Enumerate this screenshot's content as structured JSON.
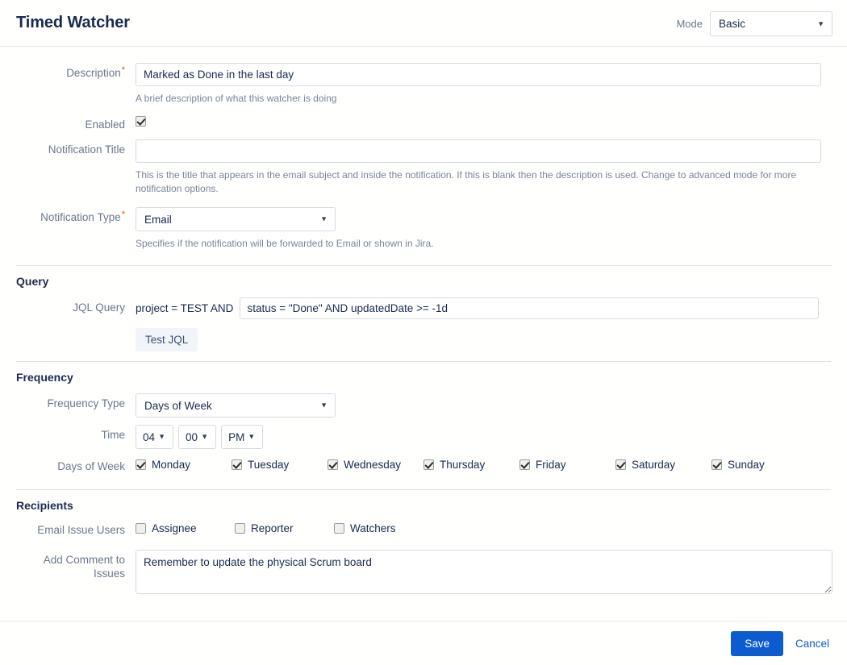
{
  "header": {
    "title": "Timed Watcher",
    "mode_label": "Mode",
    "mode_value": "Basic"
  },
  "general": {
    "description_label": "Description",
    "description_value": "Marked as Done in the last day",
    "description_placeholder": "",
    "description_help": "A brief description of what this watcher is doing",
    "enabled_label": "Enabled",
    "notification_title_label": "Notification Title",
    "notification_title_value": "",
    "notification_title_placeholder": "",
    "notification_title_help": "This is the title that appears in the email subject and inside the notification. If this is blank then the description is used. Change to advanced mode for more notification options.",
    "notification_type_label": "Notification Type",
    "notification_type_value": "Email",
    "notification_type_help": "Specifies if the notification will be forwarded to Email or shown in Jira."
  },
  "query": {
    "section_title": "Query",
    "jql_label": "JQL Query",
    "jql_prefix": "project = TEST AND",
    "jql_value": "status = \"Done\" AND updatedDate >= -1d",
    "jql_placeholder": "",
    "test_button": "Test JQL"
  },
  "frequency": {
    "section_title": "Frequency",
    "type_label": "Frequency Type",
    "type_value": "Days of Week",
    "time_label": "Time",
    "time_hour": "04",
    "time_minute": "00",
    "time_meridiem": "PM",
    "days_label": "Days of Week",
    "days": [
      {
        "label": "Monday",
        "checked": true
      },
      {
        "label": "Tuesday",
        "checked": true
      },
      {
        "label": "Wednesday",
        "checked": true
      },
      {
        "label": "Thursday",
        "checked": true
      },
      {
        "label": "Friday",
        "checked": true
      },
      {
        "label": "Saturday",
        "checked": true
      },
      {
        "label": "Sunday",
        "checked": true
      }
    ]
  },
  "recipients": {
    "section_title": "Recipients",
    "email_users_label": "Email Issue Users",
    "users": [
      {
        "label": "Assignee",
        "checked": false
      },
      {
        "label": "Reporter",
        "checked": false
      },
      {
        "label": "Watchers",
        "checked": false
      }
    ],
    "comment_label": "Add Comment to Issues",
    "comment_value": "Remember to update the physical Scrum board",
    "comment_placeholder": ""
  },
  "footer": {
    "save_label": "Save",
    "cancel_label": "Cancel"
  },
  "colors": {
    "primary": "#0c5bd1",
    "required": "#de550a",
    "label": "#6b778c",
    "text": "#172b4d"
  }
}
